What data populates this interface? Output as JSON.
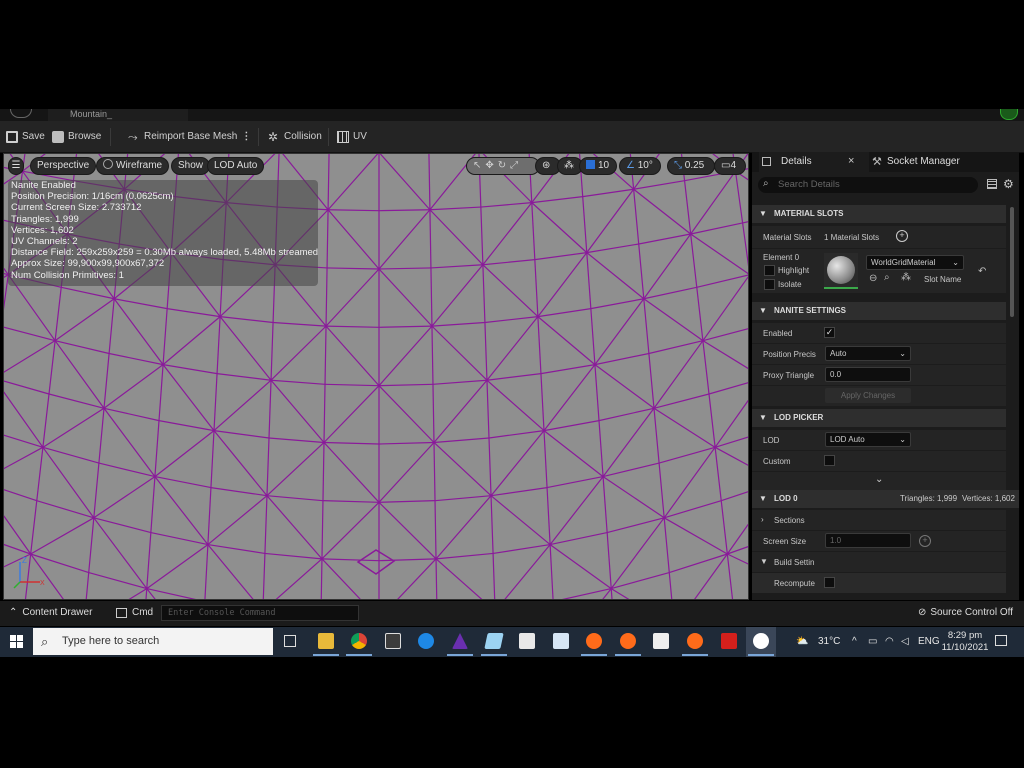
{
  "title_tab": "Mountain_",
  "toolbar": {
    "save": "Save",
    "browse": "Browse",
    "reimport": "Reimport Base Mesh",
    "collision": "Collision",
    "uv": "UV"
  },
  "viewport": {
    "perspective": "Perspective",
    "wireframe": "Wireframe",
    "show": "Show",
    "lod": "LOD Auto",
    "grid": "10",
    "angle": "10°",
    "scale": "0.25",
    "camera": "4",
    "stats": [
      "Nanite Enabled",
      "Position Precision: 1/16cm (0.0625cm)",
      "Current Screen Size: 2.733712",
      "Triangles: 1,999",
      "Vertices: 1,602",
      "UV Channels: 2",
      "Distance Field: 259x259x259 = 0.30Mb always loaded, 5.48Mb streamed",
      "Approx Size: 99,900x99,900x67,372",
      "Num Collision Primitives: 1"
    ]
  },
  "details": {
    "tab_details": "Details",
    "tab_socket": "Socket Manager",
    "search_placeholder": "Search Details",
    "material_slots_header": "MATERIAL SLOTS",
    "material_slots_label": "Material Slots",
    "material_slots_value": "1 Material Slots",
    "element_label": "Element 0",
    "highlight": "Highlight",
    "isolate": "Isolate",
    "material_name": "WorldGridMaterial",
    "slot_name": "Slot Name",
    "nanite_header": "NANITE SETTINGS",
    "enabled_label": "Enabled",
    "position_precision_label": "Position Precis",
    "position_precision_value": "Auto",
    "proxy_label": "Proxy Triangle",
    "proxy_value": "0.0",
    "apply_changes": "Apply Changes",
    "lod_picker_header": "LOD PICKER",
    "lod_label": "LOD",
    "lod_value": "LOD Auto",
    "custom_label": "Custom",
    "lod0_header": "LOD 0",
    "lod0_triangles": "Triangles: 1,999",
    "lod0_vertices": "Vertices: 1,602",
    "sections": "Sections",
    "screen_size_label": "Screen Size",
    "screen_size_value": "1.0",
    "build_settings": "Build Settin",
    "recompute": "Recompute"
  },
  "statusbar": {
    "content_drawer": "Content Drawer",
    "cmd": "Cmd",
    "console_placeholder": "Enter Console Command",
    "source_control": "Source Control Off"
  },
  "taskbar": {
    "search_placeholder": "Type here to search",
    "weather": "31°C",
    "lang": "ENG",
    "time": "8:29 pm",
    "date": "11/10/2021"
  },
  "colors": {
    "wire": "#8a1a9a",
    "viewport_bg": "#8f8f8f",
    "accent_blue": "#2a6fd6"
  }
}
